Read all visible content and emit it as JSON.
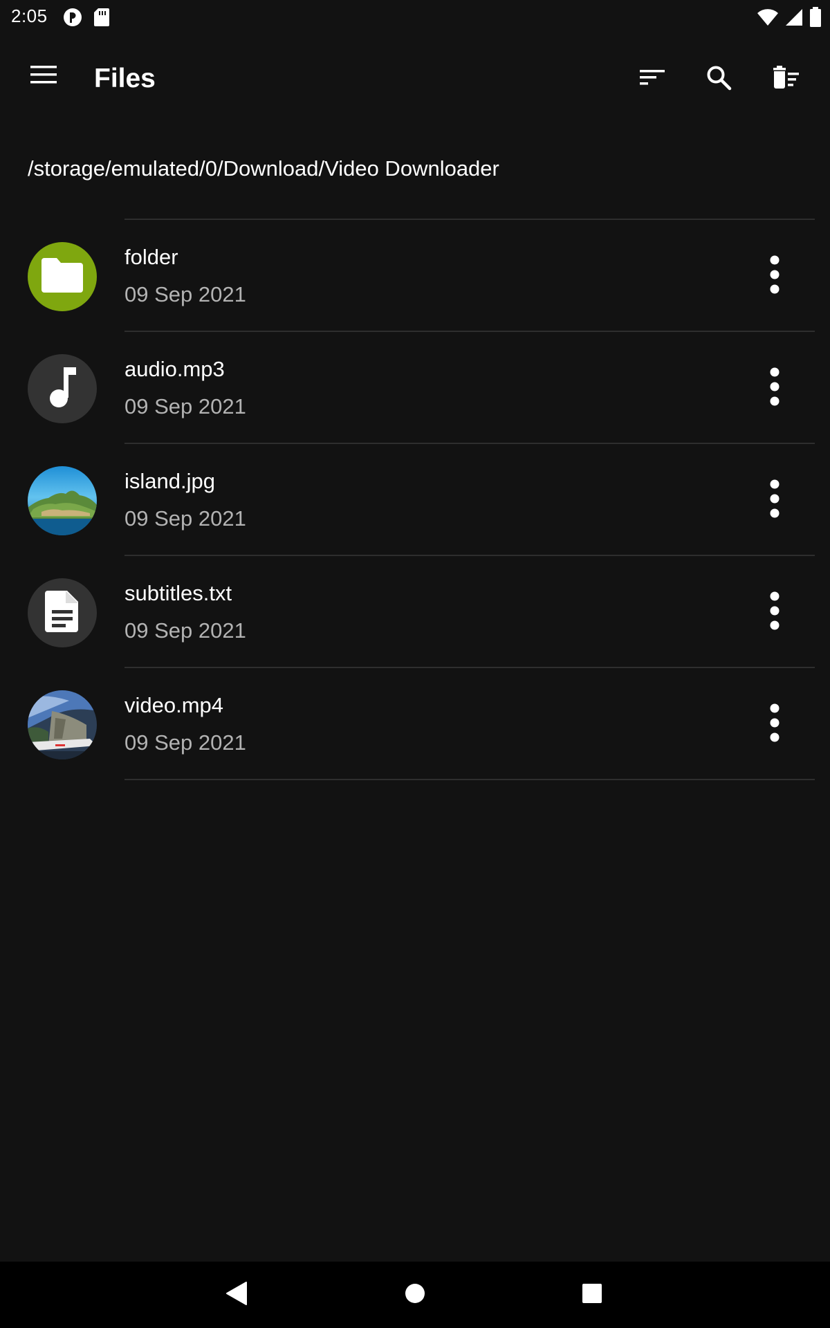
{
  "status_bar": {
    "time": "2:05",
    "left_icons": [
      "podcast-icon",
      "sd-card-icon"
    ],
    "right_icons": [
      "wifi-icon",
      "cell-signal-icon",
      "battery-icon"
    ]
  },
  "app_bar": {
    "title": "Files",
    "actions": [
      "sort-icon",
      "search-icon",
      "delete-sweep-icon"
    ]
  },
  "path": "/storage/emulated/0/Download/Video Downloader",
  "files": [
    {
      "name": "folder",
      "date": "09 Sep 2021",
      "icon": "folder-icon",
      "avatar_color": "#7fa70f"
    },
    {
      "name": "audio.mp3",
      "date": "09 Sep 2021",
      "icon": "music-note-icon",
      "avatar_color": "#333333"
    },
    {
      "name": "island.jpg",
      "date": "09 Sep 2021",
      "icon": "image-thumbnail",
      "avatar_color": "#2a8fc4"
    },
    {
      "name": "subtitles.txt",
      "date": "09 Sep 2021",
      "icon": "document-icon",
      "avatar_color": "#333333"
    },
    {
      "name": "video.mp4",
      "date": "09 Sep 2021",
      "icon": "video-thumbnail",
      "avatar_color": "#3a5a80"
    }
  ],
  "nav_bar": {
    "buttons": [
      "back-icon",
      "home-icon",
      "recents-icon"
    ]
  },
  "colors": {
    "background": "#121212",
    "divider": "#2e2e2e",
    "secondary_text": "#b3b3b3",
    "folder_accent": "#7fa70f",
    "nav_background": "#000000"
  }
}
